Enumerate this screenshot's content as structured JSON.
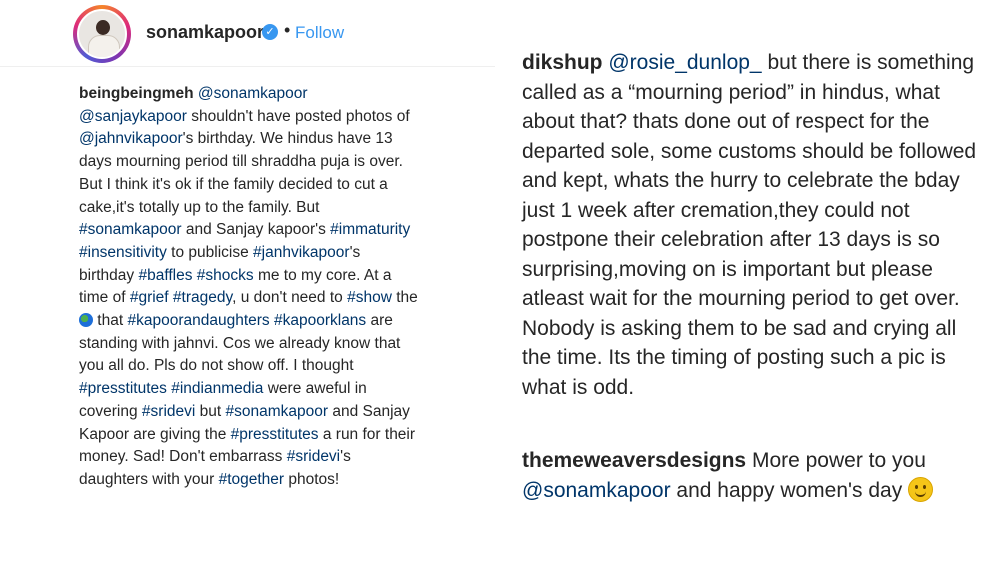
{
  "post": {
    "username": "sonamkapoor",
    "verified_symbol": "✓",
    "separator": "•",
    "follow_label": "Follow"
  },
  "left_comment": {
    "username": "beingbeingmeh",
    "segments": [
      {
        "t": "@sonamkapoor",
        "k": "m"
      },
      {
        "t": " ",
        "k": "t"
      },
      {
        "t": "@sanjaykapoor",
        "k": "m"
      },
      {
        "t": " shouldn't have posted photos of ",
        "k": "t"
      },
      {
        "t": "@jahnvikapoor",
        "k": "m"
      },
      {
        "t": "'s birthday. We hindus have 13 days mourning period till shraddha puja is over. But I think it's ok if the family decided to cut a cake,it's totally up to the family. But ",
        "k": "t"
      },
      {
        "t": "#sonamkapoor",
        "k": "m"
      },
      {
        "t": " and Sanjay kapoor's ",
        "k": "t"
      },
      {
        "t": "#immaturity",
        "k": "m"
      },
      {
        "t": " ",
        "k": "t"
      },
      {
        "t": "#insensitivity",
        "k": "m"
      },
      {
        "t": " to publicise ",
        "k": "t"
      },
      {
        "t": "#janhvikapoor",
        "k": "m"
      },
      {
        "t": "'s birthday ",
        "k": "t"
      },
      {
        "t": "#baffles",
        "k": "m"
      },
      {
        "t": " ",
        "k": "t"
      },
      {
        "t": "#shocks",
        "k": "m"
      },
      {
        "t": " me to my core. At a time of ",
        "k": "t"
      },
      {
        "t": "#grief",
        "k": "m"
      },
      {
        "t": " ",
        "k": "t"
      },
      {
        "t": "#tragedy",
        "k": "m"
      },
      {
        "t": ", u don't need to ",
        "k": "t"
      },
      {
        "t": "#show",
        "k": "m"
      },
      {
        "t": " the ",
        "k": "t"
      },
      {
        "t": "globe",
        "k": "icon"
      },
      {
        "t": " that ",
        "k": "t"
      },
      {
        "t": "#kapoorandaughters",
        "k": "m"
      },
      {
        "t": " ",
        "k": "t"
      },
      {
        "t": "#kapoorklans",
        "k": "m"
      },
      {
        "t": " are standing with jahnvi. Cos we already know that you all do. Pls do not show off. I thought ",
        "k": "t"
      },
      {
        "t": "#presstitutes",
        "k": "m"
      },
      {
        "t": " ",
        "k": "t"
      },
      {
        "t": "#indianmedia",
        "k": "m"
      },
      {
        "t": " were aweful in covering ",
        "k": "t"
      },
      {
        "t": "#sridevi",
        "k": "m"
      },
      {
        "t": " but ",
        "k": "t"
      },
      {
        "t": "#sonamkapoor",
        "k": "m"
      },
      {
        "t": " and Sanjay Kapoor are giving the ",
        "k": "t"
      },
      {
        "t": "#presstitutes",
        "k": "m"
      },
      {
        "t": " a run for their money. Sad! Don't embarrass ",
        "k": "t"
      },
      {
        "t": "#sridevi",
        "k": "m"
      },
      {
        "t": "'s daughters with your ",
        "k": "t"
      },
      {
        "t": "#together",
        "k": "m"
      },
      {
        "t": " photos!",
        "k": "t"
      }
    ]
  },
  "right_comments": [
    {
      "username": "dikshup",
      "segments": [
        {
          "t": "@rosie_dunlop_",
          "k": "m"
        },
        {
          "t": " but there is something called as a “mourning period” in hindus, what about that? thats done out of respect for the departed sole, some customs should be followed and kept, whats the hurry to celebrate the bday just 1 week after cremation,they could not postpone their celebration after 13 days is so surprising,moving on is important but please atleast wait for the mourning period to get over. Nobody is asking them to be sad and crying all the time. Its the timing of posting such a pic is what is odd.",
          "k": "t"
        }
      ]
    },
    {
      "username": "themeweaversdesigns",
      "segments": [
        {
          "t": " More power to you ",
          "k": "t"
        },
        {
          "t": "@sonamkapoor",
          "k": "m"
        },
        {
          "t": " and happy women's day ",
          "k": "t"
        },
        {
          "t": "smile",
          "k": "icon"
        }
      ]
    }
  ],
  "colors": {
    "mention": "#003569",
    "follow": "#3897f0",
    "text": "#262626"
  }
}
